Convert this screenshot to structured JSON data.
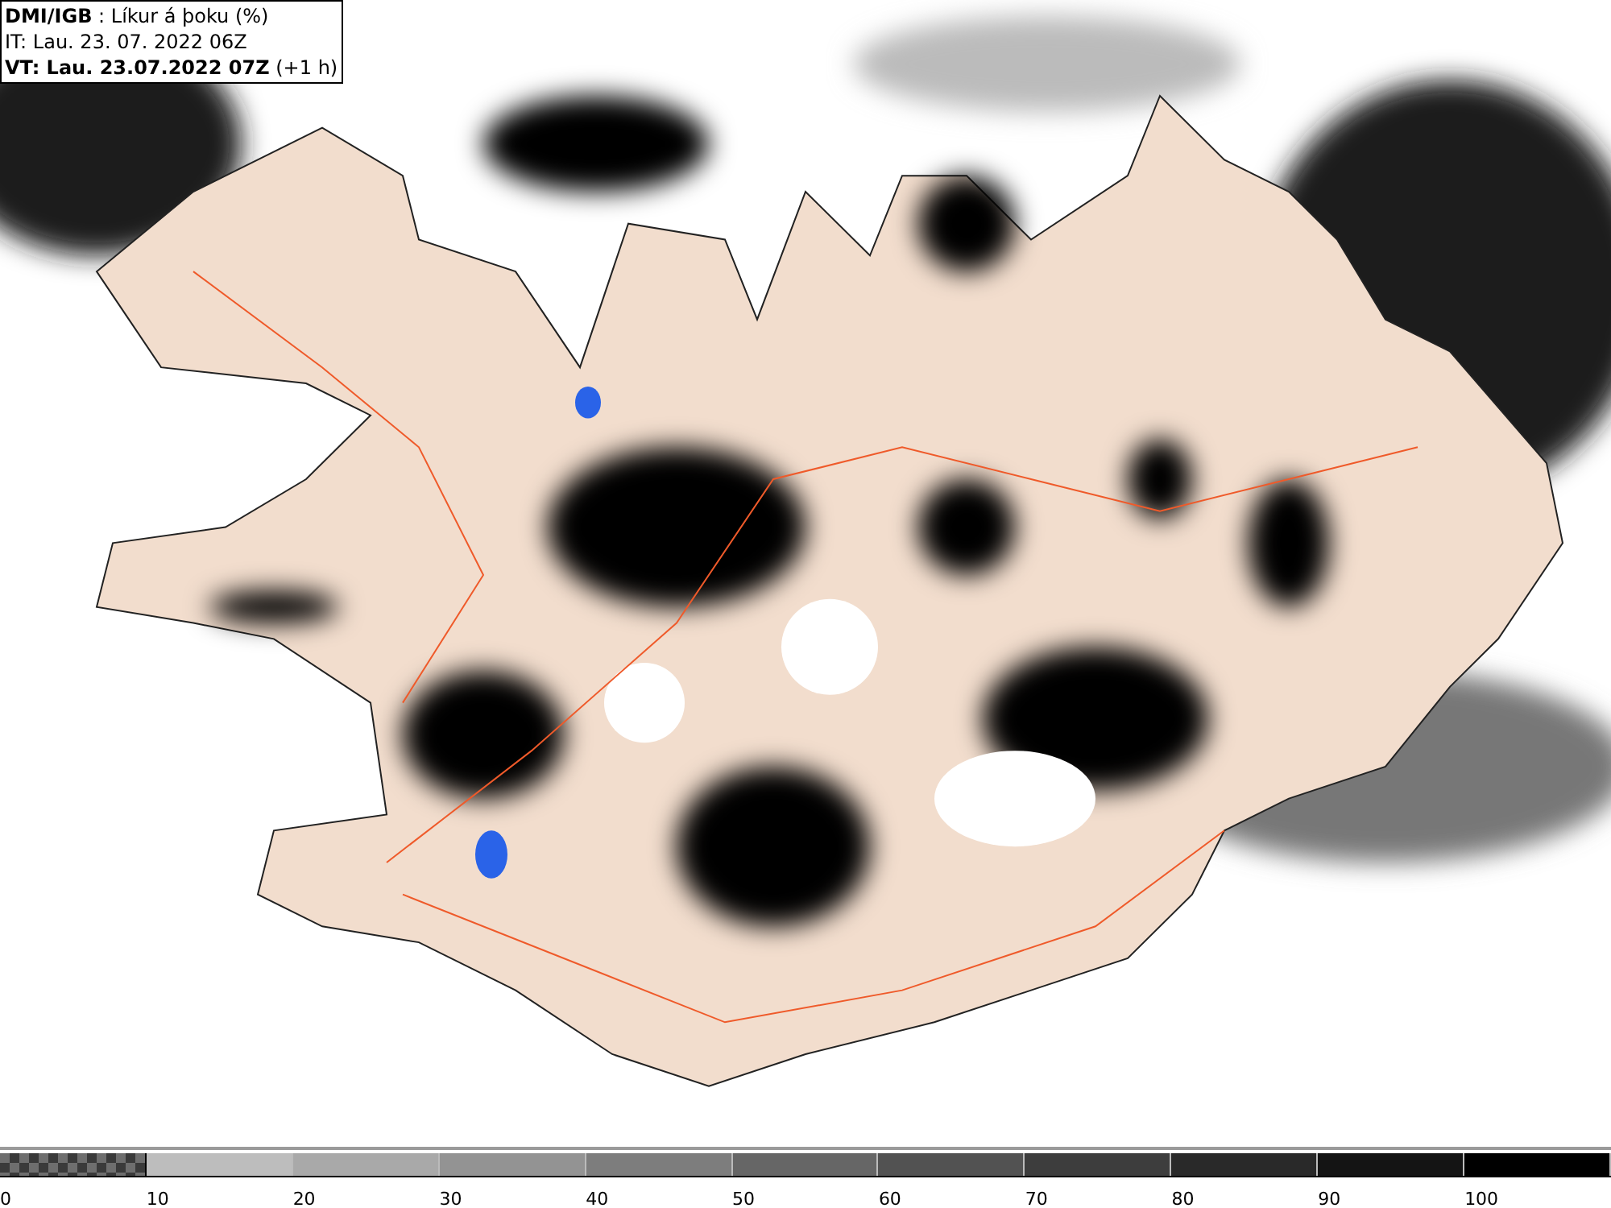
{
  "header": {
    "lines": [
      "**DMI/IGB** : Líkur á þoku (%)",
      "IT: Lau. 23. 07. 2022 06Z",
      "**VT: Lau. 23.07.2022 07Z** (+1 h)"
    ]
  },
  "legend": {
    "segments": [
      {
        "label": "0",
        "kind": "checkered",
        "color": "#6e6e6e"
      },
      {
        "label": "10",
        "kind": "solid",
        "color": "#bdbdbd"
      },
      {
        "label": "20",
        "kind": "solid",
        "color": "#a9a9a9"
      },
      {
        "label": "30",
        "kind": "solid",
        "color": "#939393"
      },
      {
        "label": "40",
        "kind": "solid",
        "color": "#7d7d7d"
      },
      {
        "label": "50",
        "kind": "solid",
        "color": "#666666"
      },
      {
        "label": "60",
        "kind": "solid",
        "color": "#525252"
      },
      {
        "label": "70",
        "kind": "solid",
        "color": "#3d3d3d"
      },
      {
        "label": "80",
        "kind": "solid",
        "color": "#292929"
      },
      {
        "label": "90",
        "kind": "solid",
        "color": "#141414"
      },
      {
        "label": "100",
        "kind": "solid",
        "color": "#000000"
      }
    ]
  }
}
